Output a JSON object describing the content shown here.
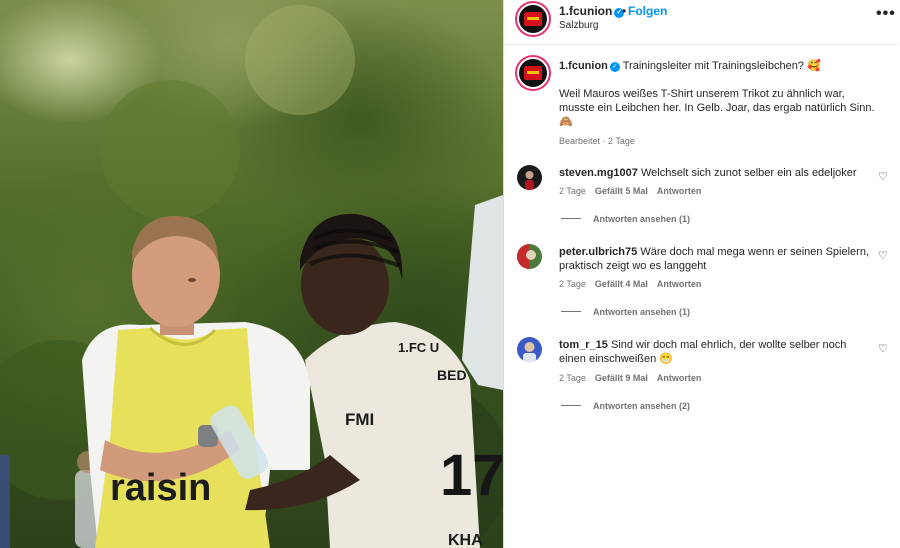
{
  "post": {
    "username": "1.fcunion",
    "verified_glyph": "✓",
    "separator": "•",
    "follow_label": "Folgen",
    "location": "Salzburg",
    "more_glyph": "•••",
    "photo_text": {
      "shirt_print": "raisin",
      "sponsor": "FMI",
      "jersey_number": "17",
      "jersey_name_top": "BED",
      "jersey_name_bottom": "KHA",
      "jersey_club": "1.FC U"
    }
  },
  "caption": {
    "username": "1.fcunion",
    "first_line": "Trainingsleiter mit Trainingsleibchen? 🥰",
    "body_line1": "Weil Mauros weißes T-Shirt unserem Trikot zu ähnlich war,",
    "body_line2": "musste ein Leibchen her. In Gelb. Joar, das ergab natürlich Sinn.",
    "body_line3": "🙈",
    "meta": "Bearbeitet · 2 Tage"
  },
  "comments": [
    {
      "username": "steven.mg1007",
      "text_line1": "Welchselt sich zunot selber ein als edeljoker",
      "text_line2": "",
      "time": "2 Tage",
      "likes": "Gefällt 5 Mal",
      "reply_label": "Antworten",
      "view_replies": "Antworten ansehen (1)",
      "avatar_color": "#1a1a1a"
    },
    {
      "username": "peter.ulbrich75",
      "text_line1": "Wäre doch mal mega wenn er seinen Spielern,",
      "text_line2": "praktisch zeigt wo es langgeht",
      "time": "2 Tage",
      "likes": "Gefällt 4 Mal",
      "reply_label": "Antworten",
      "view_replies": "Antworten ansehen (1)",
      "avatar_color": "#4b7a3a"
    },
    {
      "username": "tom_r_15",
      "text_line1": "Sind wir doch mal ehrlich, der wollte selber noch",
      "text_line2": "einen einschweißen 😁",
      "time": "2 Tage",
      "likes": "Gefällt 9 Mal",
      "reply_label": "Antworten",
      "view_replies": "Antworten ansehen (2)",
      "avatar_color": "#3a5bc7"
    }
  ],
  "icons": {
    "heart": "♡"
  },
  "colors": {
    "accent_blue": "#0095f6",
    "meta_grey": "#737373",
    "bib_yellow": "#e7e05a",
    "club_red": "#d4121c"
  }
}
